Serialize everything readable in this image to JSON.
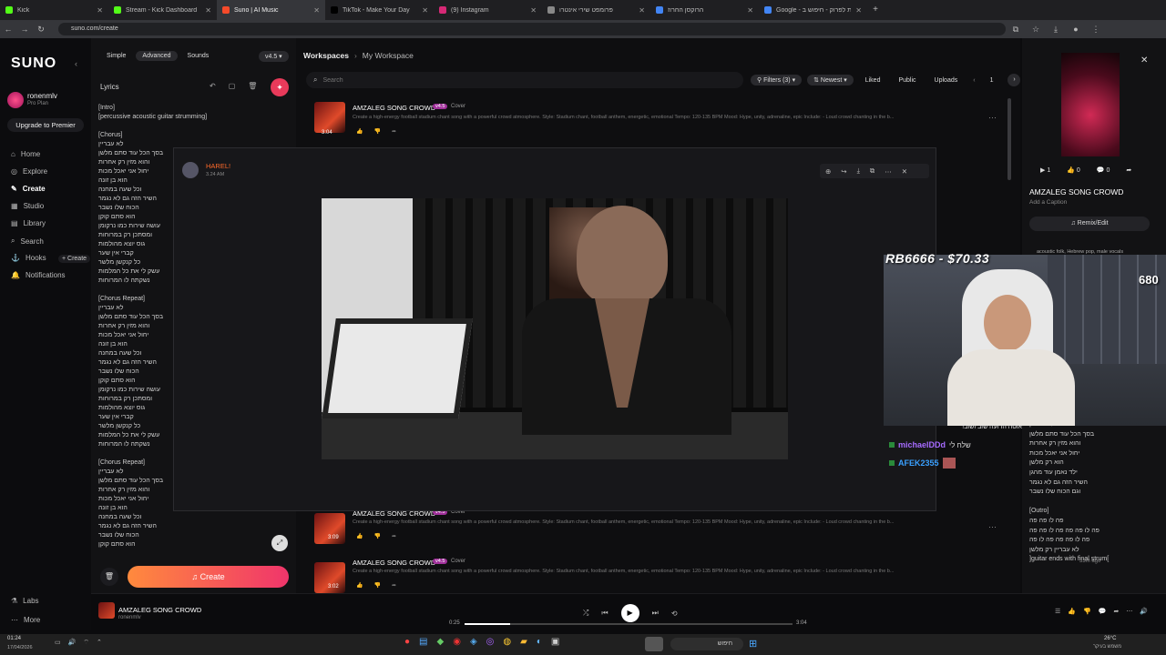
{
  "browser": {
    "tabs": [
      {
        "title": "Kick",
        "color": "#53fc18",
        "active": false
      },
      {
        "title": "Stream - Kick Dashboard",
        "color": "#53fc18",
        "active": false
      },
      {
        "title": "Suno | AI Music",
        "color": "#f54a2a",
        "active": true
      },
      {
        "title": "TikTok - Make Your Day",
        "color": "#000000",
        "active": false
      },
      {
        "title": "(9) Instagram",
        "color": "#d62976",
        "active": false
      },
      {
        "title": "פרומפט שירי אינטרו",
        "color": "#888888",
        "active": false
      },
      {
        "title": "הרוקסן החרוז",
        "color": "#4285f4",
        "active": false
      },
      {
        "title": "Google - גן חיות לפרוק - חיפוש ב",
        "color": "#4285f4",
        "active": false
      }
    ],
    "new_tab": "+",
    "url": "suno.com/create"
  },
  "sidebar": {
    "logo": "SUNO",
    "user": {
      "name": "ronenmlv",
      "plan": "Pro Plan"
    },
    "upgrade": "Upgrade to Premier",
    "items": [
      "Home",
      "Explore",
      "Create",
      "Studio",
      "Library",
      "Search",
      "Hooks",
      "Notifications"
    ],
    "hooks_create": "+ Create",
    "bottom": [
      "Labs",
      "More"
    ]
  },
  "create": {
    "modes": [
      "Simple",
      "Advanced",
      "Sounds"
    ],
    "version": "v4.5",
    "lyrics_label": "Lyrics",
    "lyrics": "[Intro]\n[percussive acoustic guitar strumming]\n\n[Chorus]\nלא עבריין\nבסך הכל עוד סתם מלשן\nוהוא מזין רק אחרות\nיחול אני יאכל מכות\nהוא בן זונה\nוכל שעה במחנה\nהשיר הזה גם לא נגמר\nהכוח שלו נשבר\nהוא סתם קוקן\nעושה שירות כמו נרקומן\nומסתכן רק במרוחות\nגוס יוצא מהולמות\nקברי אין שער\nכל קנקשן מלשר\nעשק לי את כל המלמות\nנשקתה לו המרוחות\n\n[Chorus Repeat]\nלא עבריין\nבסך הכל עוד סתם מלשן\nוהוא מזין רק אחרות\nיחול אני יאכל מכות\nהוא בן זונה\nוכל שעה במחנה\nהשיר הזה גם לא נגמר\nהכוח שלו נשבר\nהוא סתם קוקן\nעושה שירות כמו נרקומן\nומסתכן רק במרוחות\nגוס יוצא מהולמות\nקברי אין שער\nכל קנקשן מלשר\nעשק לי את כל המלמות\nנשקתה לו המרוחות\n\n[Chorus Repeat]\nלא עבריין\nבסך הכל עוד סתם מלשן\nוהוא מזין רק אחרות\nיחול אני יאכל מכות\nהוא בן זונה\nוכל שעה במחנה\nהשיר הזה גם לא נגמר\nהכוח שלו נשבר\nהוא סתם קוקן",
    "create_btn": "Create"
  },
  "workspace": {
    "breadcrumb": [
      "Workspaces",
      "My Workspace"
    ],
    "search_placeholder": "Search",
    "filters": "Filters (3)",
    "sort": "Newest",
    "toggles": [
      "Liked",
      "Public",
      "Uploads"
    ],
    "page": "1",
    "songs": [
      {
        "title": "AMZALEG SONG CROWD",
        "badge": "v4.5",
        "tag": "Cover",
        "desc": "Create a high-energy football stadium chant song with a powerful crowd atmosphere. Style: Stadium chant, football anthem, energetic, emotional Tempo: 120-135 BPM Mood: Hype, unity, adrenaline, epic Include: - Loud crowd chanting in the b...",
        "duration": "3:04"
      },
      {
        "title": "AMZALEG SONG CROWD",
        "badge": "v4.5",
        "tag": "Cover",
        "desc": "Create a high-energy football stadium chant song with a powerful crowd atmosphere. Style: Stadium chant, football anthem, energetic, emotional Tempo: 120-135 BPM Mood: Hype, unity, adrenaline, epic Include: - Loud crowd chanting in the b...",
        "duration": "3:09"
      },
      {
        "title": "AMZALEG SONG CROWD",
        "badge": "v4.5",
        "tag": "Cover",
        "desc": "Create a high-energy football stadium chant song with a powerful crowd atmosphere. Style: Stadium chant, football anthem, energetic, emotional Tempo: 120-135 BPM Mood: Hype, unity, adrenaline, epic Include: - Loud crowd chanting in the b...",
        "duration": "3:02"
      }
    ]
  },
  "detail": {
    "plays": "1",
    "likes": "0",
    "comments": "0",
    "title": "AMZALEG SONG CROWD",
    "caption": "Add a Caption",
    "remix": "Remix/Edit",
    "tags": "acoustic folk, Hebrew pop, male vocals",
    "lyrics_tail": "לא עבריין\nבסך הכל עוד סתם מלשן\nוהוא מזין רק אחרות\nיחול אני יאכל מכות\nהוא רק מלשן\nילד נאמן עוד מהגן\nהשיר הזה גם לא נגמר\nוגם הכוח שלו נשבר\n\n[Outro]\nפה לו פה פה\nפה לו פה פה פה לו פה פה\nפה לו פה פה פה לו פה\nלא עבריין רק מלשן\n[guitar ends with final strum]",
    "time_ago": "33m ago"
  },
  "overlay": {
    "author": "HAREL!",
    "sub": "3.24 AM",
    "donation": "RB6666 - $70.33",
    "viewers": "680",
    "chat": [
      {
        "user": "",
        "text": "אוטה הדועה שוב ושוב!"
      },
      {
        "user": "michaelDDd",
        "text": "שלח לי"
      },
      {
        "user": "AFEK2355",
        "text": ""
      }
    ]
  },
  "player": {
    "title": "AMZALEG SONG CROWD",
    "artist": "ronenmlv",
    "current": "0:25",
    "total": "3:04",
    "progress": 0.14
  },
  "taskbar": {
    "time": "01:24",
    "date": "17/04/2026",
    "weather": "26°C",
    "weather_text": "משמש בעיקר",
    "search": "חיפוש"
  }
}
